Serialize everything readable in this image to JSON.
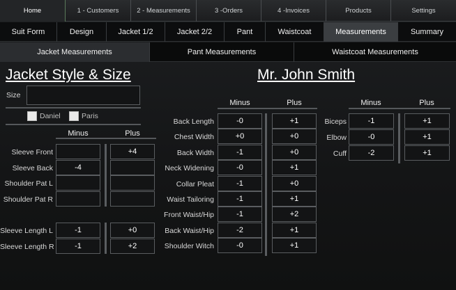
{
  "nav_main": [
    "Home",
    "1 - Customers",
    "2 - Measurements",
    "3 -Orders",
    "4 -Invoices",
    "Products",
    "Settings"
  ],
  "nav_sub": [
    "Suit Form",
    "Design",
    "Jacket 1/2",
    "Jacket 2/2",
    "Pant",
    "Waistcoat",
    "Measurements",
    "Summary"
  ],
  "nav_meas": [
    "Jacket Measurements",
    "Pant Measurements",
    "Waistcoat Measurements"
  ],
  "jacket": {
    "title": "Jacket Style & Size",
    "size_label": "Size",
    "size_value": "",
    "options": [
      "Daniel",
      "Paris"
    ],
    "minus_label": "Minus",
    "plus_label": "Plus",
    "rows1": [
      {
        "label": "Sleeve Front",
        "minus": "",
        "plus": "+4"
      },
      {
        "label": "Sleeve Back",
        "minus": "-4",
        "plus": ""
      },
      {
        "label": "Shoulder Pat L",
        "minus": "",
        "plus": ""
      },
      {
        "label": "Shoulder Pat R",
        "minus": "",
        "plus": ""
      }
    ],
    "rows2": [
      {
        "label": "Sleeve Length L",
        "minus": "-1",
        "plus": "+0"
      },
      {
        "label": "Sleeve Length R",
        "minus": "-1",
        "plus": "+2"
      }
    ]
  },
  "customer": {
    "name": "Mr. John Smith",
    "minus_label": "Minus",
    "plus_label": "Plus",
    "rows": [
      {
        "label": "Back Length",
        "minus": "-0",
        "plus": "+1"
      },
      {
        "label": "Chest Width",
        "minus": "+0",
        "plus": "+0"
      },
      {
        "label": "Back Width",
        "minus": "-1",
        "plus": "+0"
      },
      {
        "label": "Neck Widening",
        "minus": "-0",
        "plus": "+1"
      },
      {
        "label": "Collar Pleat",
        "minus": "-1",
        "plus": "+0"
      },
      {
        "label": "Waist Tailoring",
        "minus": "-1",
        "plus": "+1"
      },
      {
        "label": "Front Waist/Hip",
        "minus": "-1",
        "plus": "+2"
      },
      {
        "label": "Back Waist/Hip",
        "minus": "-2",
        "plus": "+1"
      },
      {
        "label": "Shoulder Witch",
        "minus": "-0",
        "plus": "+1"
      }
    ]
  },
  "arm": {
    "minus_label": "Minus",
    "plus_label": "Plus",
    "rows": [
      {
        "label": "Biceps",
        "minus": "-1",
        "plus": "+1"
      },
      {
        "label": "Elbow",
        "minus": "-0",
        "plus": "+1"
      },
      {
        "label": "Cuff",
        "minus": "-2",
        "plus": "+1"
      }
    ]
  }
}
